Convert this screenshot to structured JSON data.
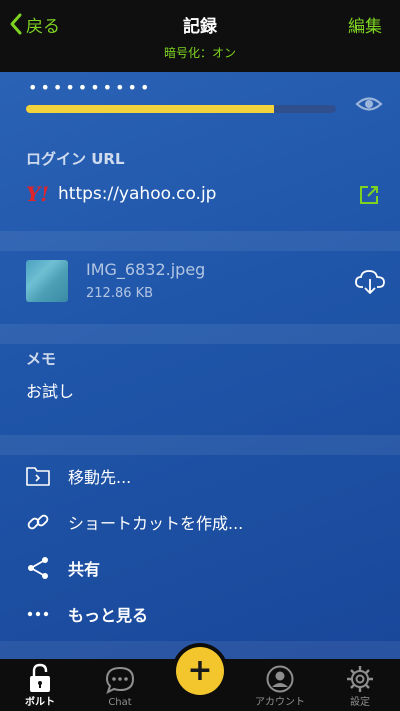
{
  "header": {
    "back_label": "戻る",
    "title": "記録",
    "subtitle": "暗号化：オン",
    "edit_label": "編集"
  },
  "password": {
    "masked": "••••••••••",
    "strength_fraction": 0.8
  },
  "login_url": {
    "label": "ログイン URL",
    "value": "https://yahoo.co.jp",
    "site_icon": "yahoo-y-icon"
  },
  "attachment": {
    "name": "IMG_6832.jpeg",
    "size": "212.86 KB"
  },
  "memo": {
    "label": "メモ",
    "text": "お試し"
  },
  "actions": [
    {
      "label": "移動先...",
      "icon": "folder-move-icon"
    },
    {
      "label": "ショートカットを作成...",
      "icon": "link-icon"
    },
    {
      "label": "共有",
      "icon": "share-icon"
    },
    {
      "label": "もっと見る",
      "icon": "more-icon"
    }
  ],
  "tabbar": {
    "tabs": [
      {
        "label": "ボルト",
        "icon": "lock-icon"
      },
      {
        "label": "Chat",
        "icon": "chat-icon"
      },
      {
        "label": "アカウント",
        "icon": "account-icon"
      },
      {
        "label": "設定",
        "icon": "gear-icon"
      }
    ],
    "fab_label": "+"
  },
  "colors": {
    "accent_green": "#7ed321",
    "strength_yellow": "#f3d33d",
    "fab_yellow": "#f3c62e",
    "background_blue": "#1f55a8"
  }
}
